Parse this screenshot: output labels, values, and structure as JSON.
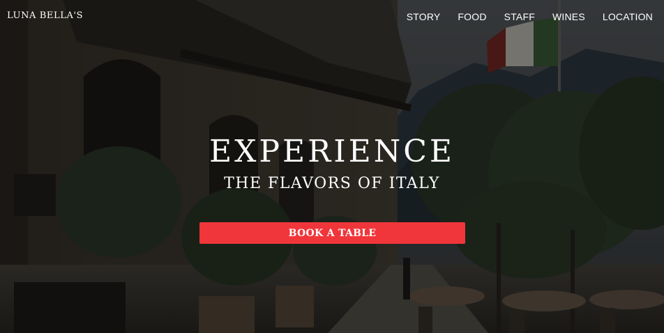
{
  "brand": {
    "name": "LUNA BELLA'S"
  },
  "nav": {
    "items": [
      {
        "label": "STORY"
      },
      {
        "label": "FOOD"
      },
      {
        "label": "STAFF"
      },
      {
        "label": "WINES"
      },
      {
        "label": "LOCATION"
      }
    ]
  },
  "hero": {
    "headline": "EXPERIENCE",
    "subheadline": "THE FLAVORS OF ITALY",
    "cta_label": "BOOK A TABLE",
    "background_image": "italian-street-cafe-photo"
  },
  "colors": {
    "accent": "#f0363a",
    "text": "#ffffff",
    "overlay": "#000000"
  }
}
